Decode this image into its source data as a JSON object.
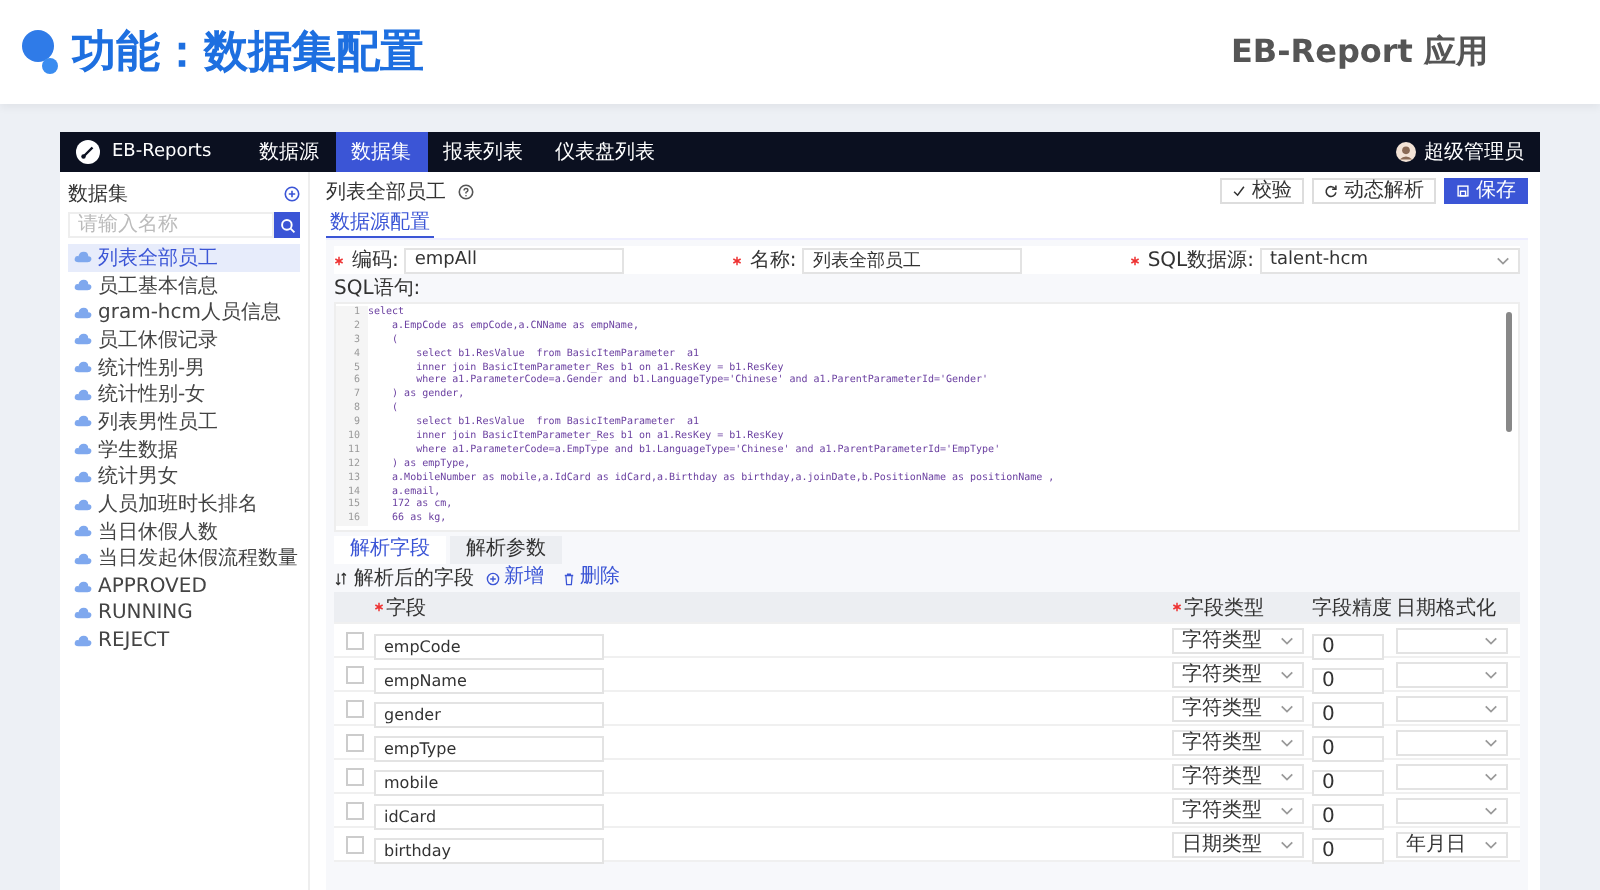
{
  "header": {
    "title": "功能：数据集配置",
    "brand": "EB-Report 应用"
  },
  "navbar": {
    "app_name": "EB-Reports",
    "tabs": [
      {
        "label": "数据源",
        "selected": false
      },
      {
        "label": "数据集",
        "selected": true
      },
      {
        "label": "报表列表",
        "selected": false
      },
      {
        "label": "仪表盘列表",
        "selected": false
      }
    ],
    "user": "超级管理员"
  },
  "sidebar": {
    "title": "数据集",
    "search": {
      "placeholder": "请输入名称"
    },
    "items": [
      {
        "label": "列表全部员工",
        "selected": true
      },
      {
        "label": "员工基本信息",
        "selected": false
      },
      {
        "label": "gram-hcm人员信息",
        "selected": false
      },
      {
        "label": "员工休假记录",
        "selected": false
      },
      {
        "label": "统计性别-男",
        "selected": false
      },
      {
        "label": "统计性别-女",
        "selected": false
      },
      {
        "label": "列表男性员工",
        "selected": false
      },
      {
        "label": "学生数据",
        "selected": false
      },
      {
        "label": "统计男女",
        "selected": false
      },
      {
        "label": "人员加班时长排名",
        "selected": false
      },
      {
        "label": "当日休假人数",
        "selected": false
      },
      {
        "label": "当日发起休假流程数量",
        "selected": false
      },
      {
        "label": "APPROVED",
        "selected": false
      },
      {
        "label": "RUNNING",
        "selected": false
      },
      {
        "label": "REJECT",
        "selected": false
      }
    ]
  },
  "main": {
    "title": "列表全部员工",
    "buttons": [
      {
        "label": "校验",
        "kind": "check"
      },
      {
        "label": "动态解析",
        "kind": "refresh"
      },
      {
        "label": "保存",
        "kind": "save"
      }
    ],
    "tabs": [
      {
        "label": "数据源配置",
        "selected": true
      }
    ],
    "form": {
      "code": {
        "label": "编码:",
        "required": true,
        "value": "empAll"
      },
      "name": {
        "label": "名称:",
        "required": true,
        "value": "列表全部员工"
      },
      "datasource": {
        "label": "SQL数据源:",
        "required": true,
        "value": "talent-hcm"
      },
      "sql_label": "SQL语句:"
    },
    "sql_lines": [
      {
        "no": "1",
        "code": "select"
      },
      {
        "no": "2",
        "code": "    a.EmpCode as empCode,a.CNName as empName,"
      },
      {
        "no": "3",
        "code": "    ("
      },
      {
        "no": "4",
        "code": "        select b1.ResValue  from BasicItemParameter  a1"
      },
      {
        "no": "5",
        "code": "        inner join BasicItemParameter_Res b1 on a1.ResKey = b1.ResKey"
      },
      {
        "no": "6",
        "code": "        where a1.ParameterCode=a.Gender and b1.LanguageType='Chinese' and a1.ParentParameterId='Gender'"
      },
      {
        "no": "7",
        "code": "    ) as gender,"
      },
      {
        "no": "8",
        "code": "    ("
      },
      {
        "no": "9",
        "code": "        select b1.ResValue  from BasicItemParameter  a1"
      },
      {
        "no": "10",
        "code": "        inner join BasicItemParameter_Res b1 on a1.ResKey = b1.ResKey"
      },
      {
        "no": "11",
        "code": "        where a1.ParameterCode=a.EmpType and b1.LanguageType='Chinese' and a1.ParentParameterId='EmpType'"
      },
      {
        "no": "12",
        "code": "    ) as empType,"
      },
      {
        "no": "13",
        "code": "    a.MobileNumber as mobile,a.IdCard as idCard,a.Birthday as birthday,a.joinDate,b.PositionName as positionName ,"
      },
      {
        "no": "14",
        "code": "    a.email,"
      },
      {
        "no": "15",
        "code": "    172 as cm,"
      },
      {
        "no": "16",
        "code": "    66 as kg,"
      }
    ],
    "sub_tabs": [
      {
        "label": "解析字段",
        "selected": true
      },
      {
        "label": "解析参数",
        "selected": false
      }
    ],
    "toolbar": {
      "label": "解析后的字段",
      "add": "新增",
      "delete": "删除"
    },
    "table": {
      "columns": [
        {
          "label": "字段",
          "required": true
        },
        {
          "label": "字段类型",
          "required": true
        },
        {
          "label": "字段精度",
          "required": false
        },
        {
          "label": "日期格式化",
          "required": false
        }
      ],
      "rows": [
        {
          "checked": false,
          "field": "empCode",
          "type": "字符类型",
          "precision": "0"
        },
        {
          "checked": false,
          "field": "empName",
          "type": "字符类型",
          "precision": "0"
        },
        {
          "checked": false,
          "field": "gender",
          "type": "字符类型",
          "precision": "0"
        },
        {
          "checked": false,
          "field": "empType",
          "type": "字符类型",
          "precision": "0"
        },
        {
          "checked": false,
          "field": "mobile",
          "type": "字符类型",
          "precision": "0"
        },
        {
          "checked": false,
          "field": "idCard",
          "type": "字符类型",
          "precision": "0"
        },
        {
          "checked": false,
          "field": "birthday",
          "type": "日期类型",
          "precision": "0",
          "date_format": "年月日"
        }
      ]
    }
  }
}
